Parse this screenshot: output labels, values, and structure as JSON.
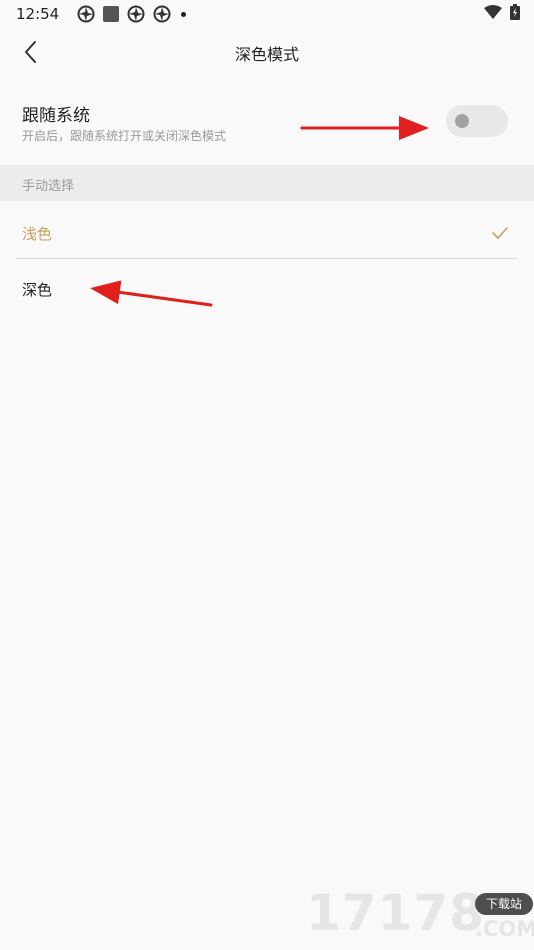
{
  "status_bar": {
    "time": "12:54",
    "icons": [
      "aperture-icon",
      "square-icon",
      "aperture-icon",
      "aperture-icon",
      "dot-icon",
      "wifi-icon",
      "battery-icon"
    ]
  },
  "header": {
    "title": "深色模式",
    "back_icon": "chevron-left-icon"
  },
  "follow_system": {
    "title": "跟随系统",
    "subtitle": "开启后，跟随系统打开或关闭深色模式",
    "toggle_on": false
  },
  "manual": {
    "section_label": "手动选择",
    "options": [
      {
        "label": "浅色",
        "selected": true
      },
      {
        "label": "深色",
        "selected": false
      }
    ]
  },
  "watermark": {
    "numbers": "17178",
    "badge": "下载站",
    "domain": ".COM"
  },
  "colors": {
    "background": "#f9f9f9",
    "section_bg": "#ececec",
    "selected_accent": "#c7a05d",
    "toggle_track": "#e8e8e8",
    "toggle_knob": "#a2a2a2",
    "annotation_red": "#e0201c"
  }
}
